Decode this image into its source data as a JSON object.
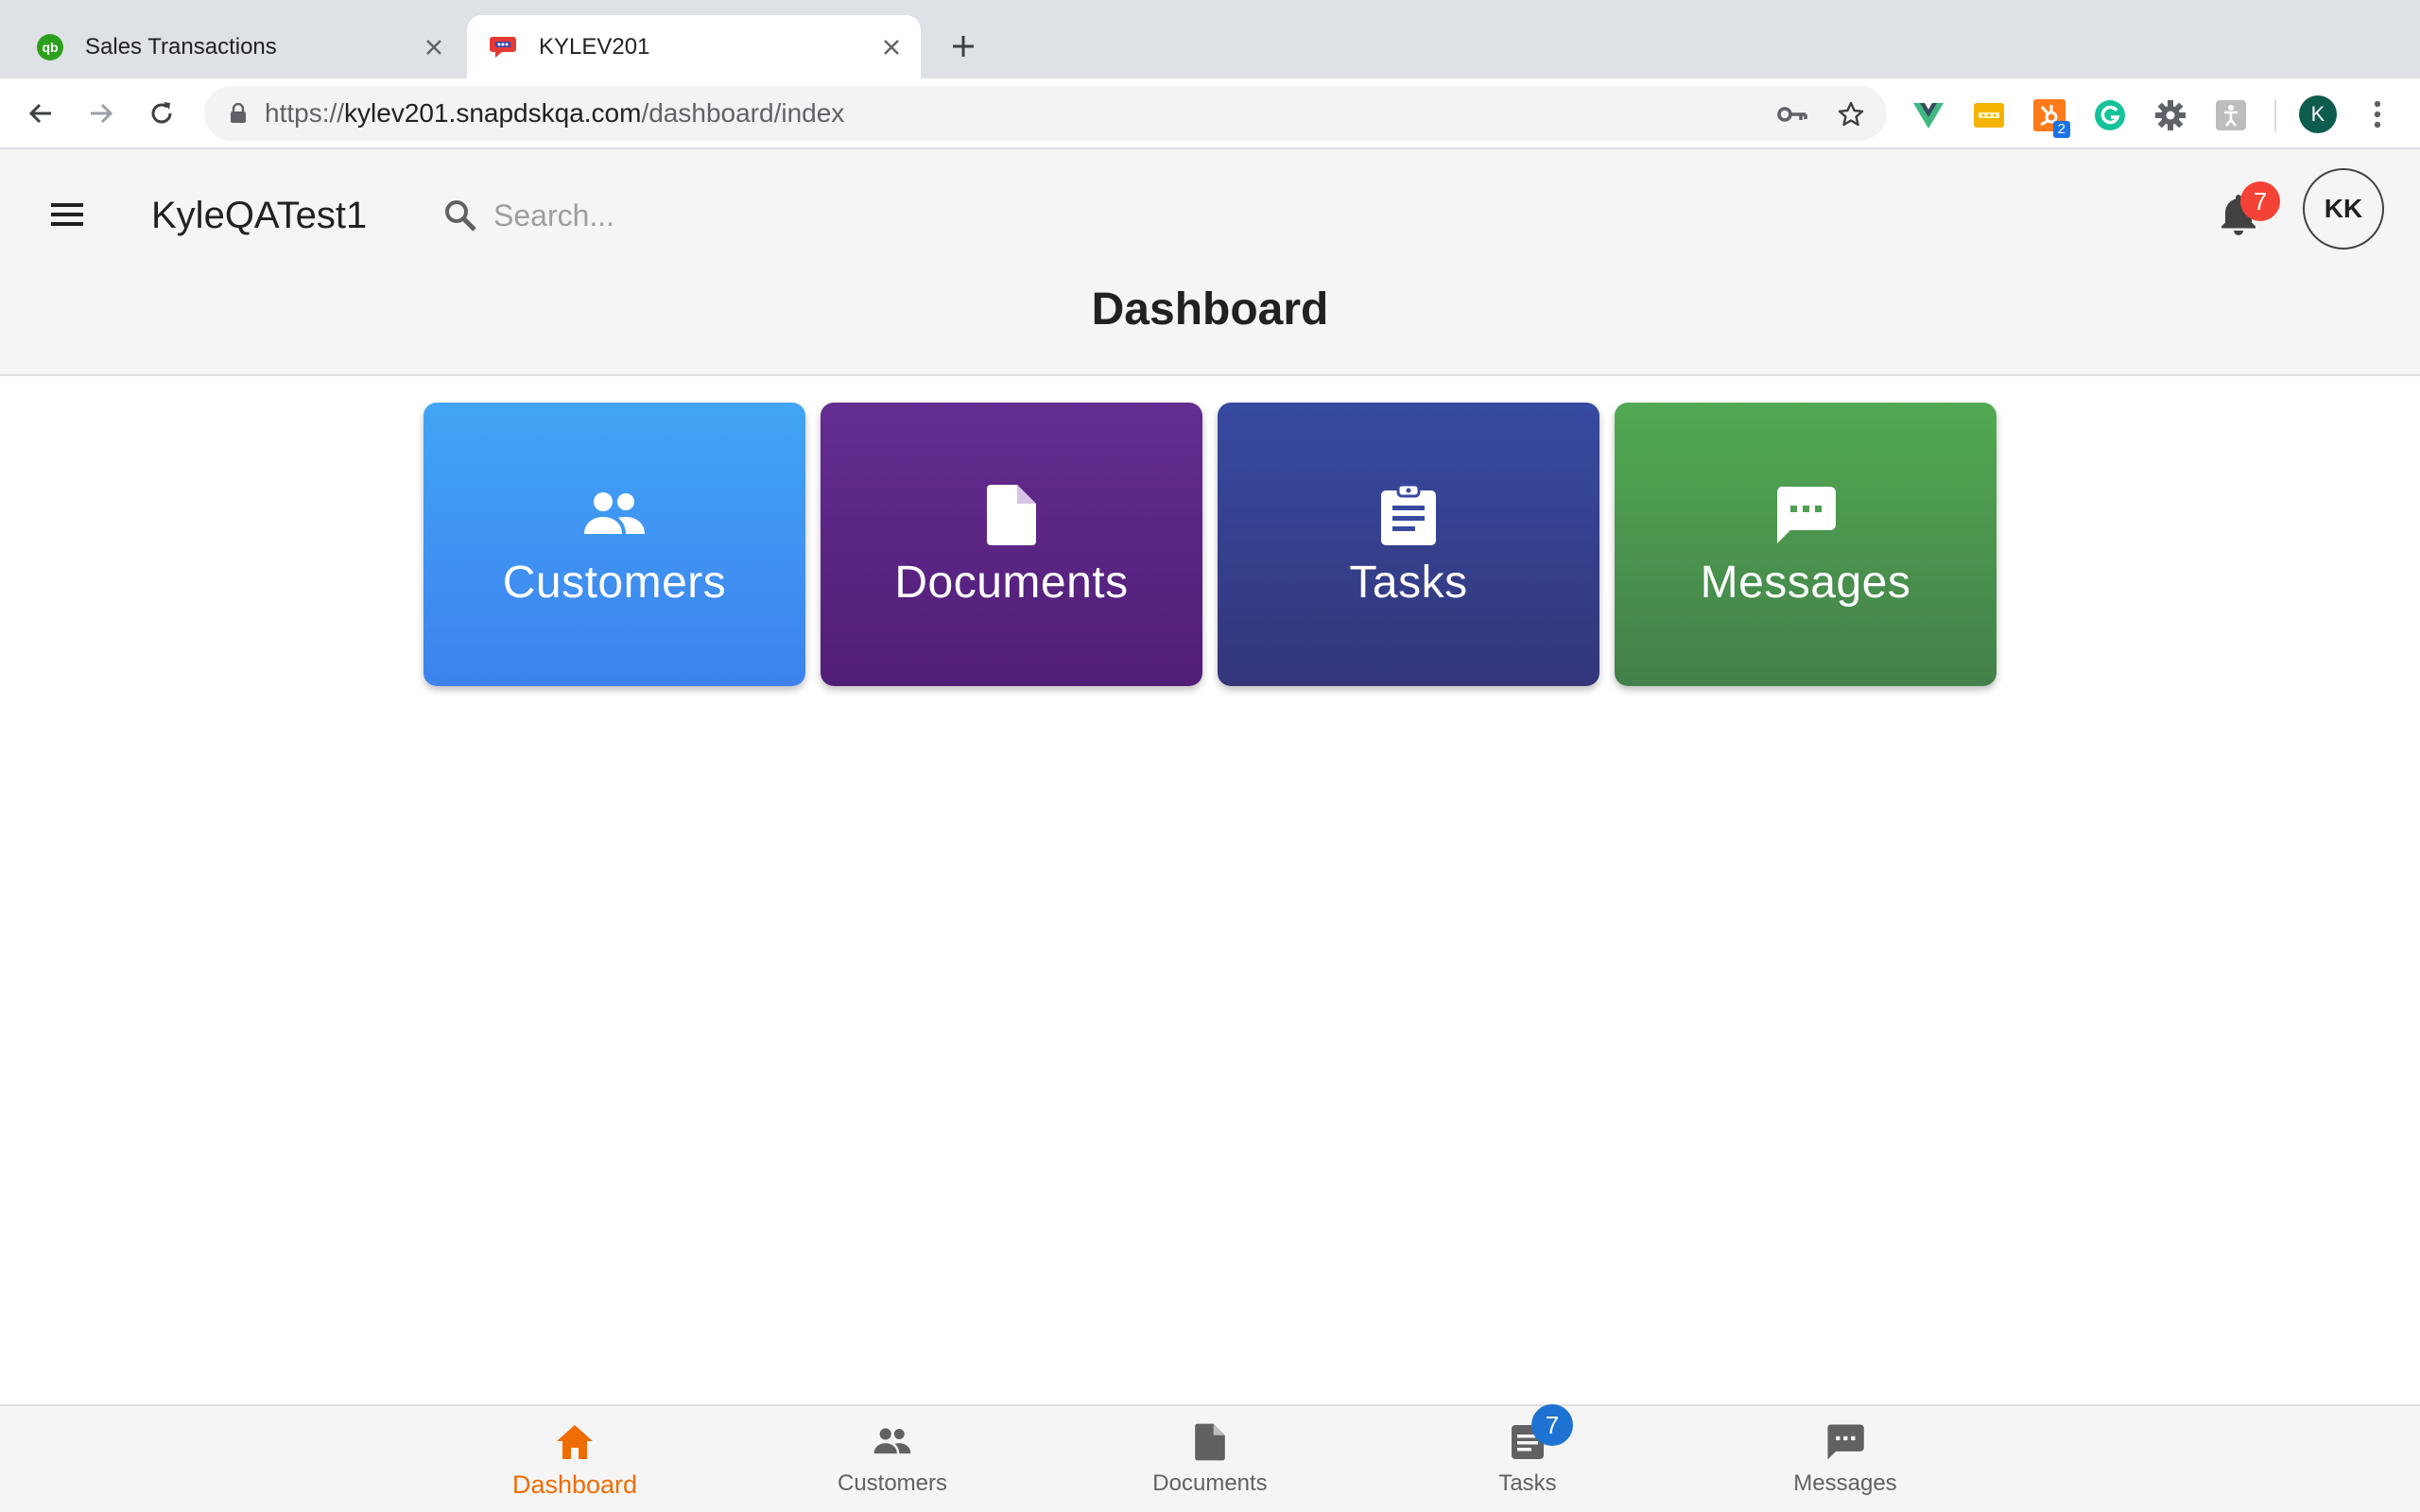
{
  "browser": {
    "tabs": [
      {
        "title": "Sales Transactions",
        "active": false,
        "favicon": "quickbooks-icon"
      },
      {
        "title": "KYLEV201",
        "active": true,
        "favicon": "chat-bubble-icon"
      }
    ],
    "url_prefix": "https://",
    "url_host": "kylev201.snapdskqa.com",
    "url_path": "/dashboard/index",
    "extension_badge": "2",
    "profile_initial": "K"
  },
  "header": {
    "company_name": "KyleQATest1",
    "search_placeholder": "Search...",
    "notification_count": "7",
    "user_initials": "KK",
    "page_title": "Dashboard"
  },
  "tiles": [
    {
      "label": "Customers",
      "icon": "customers-icon",
      "color": "#42a5f5"
    },
    {
      "label": "Documents",
      "icon": "document-icon",
      "color": "#5e2a8a"
    },
    {
      "label": "Tasks",
      "icon": "clipboard-icon",
      "color": "#36449a"
    },
    {
      "label": "Messages",
      "icon": "message-icon",
      "color": "#4e9f4f"
    }
  ],
  "bottom_nav": {
    "items": [
      {
        "label": "Dashboard",
        "icon": "home-icon",
        "active": true
      },
      {
        "label": "Customers",
        "icon": "customers-icon",
        "active": false
      },
      {
        "label": "Documents",
        "icon": "document-icon",
        "active": false
      },
      {
        "label": "Tasks",
        "icon": "tasks-icon",
        "active": false,
        "badge": "7"
      },
      {
        "label": "Messages",
        "icon": "message-icon",
        "active": false
      }
    ],
    "active_color": "#ef6c00"
  }
}
